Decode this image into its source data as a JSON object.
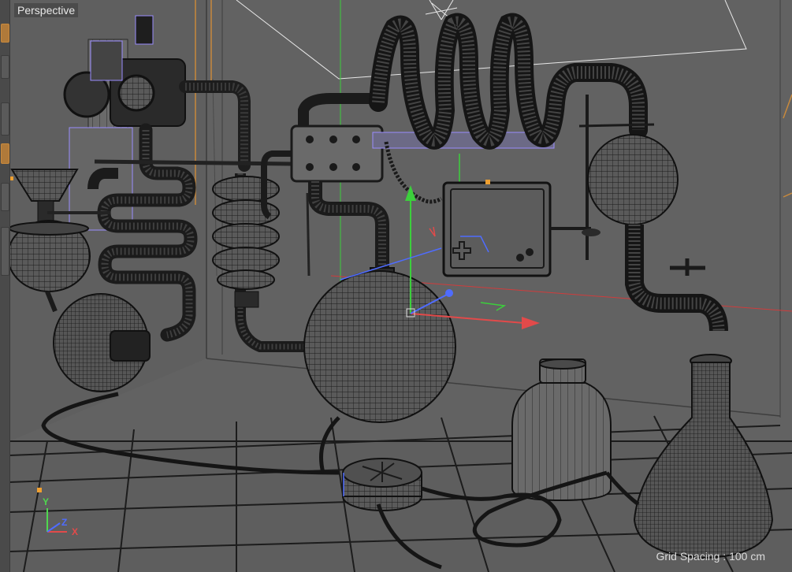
{
  "viewport": {
    "label": "Perspective",
    "grid_spacing_text": "Grid Spacing : 100 cm"
  },
  "axes": {
    "x": "X",
    "y": "Y",
    "z": "Z"
  },
  "colors": {
    "background": "#5e5e5e",
    "wire": "#141414",
    "selection": "#f0a030",
    "bbox": "#9a8cff",
    "axis_x": "#e24a4a",
    "axis_y": "#4fd84f",
    "axis_z": "#4f6cff"
  }
}
